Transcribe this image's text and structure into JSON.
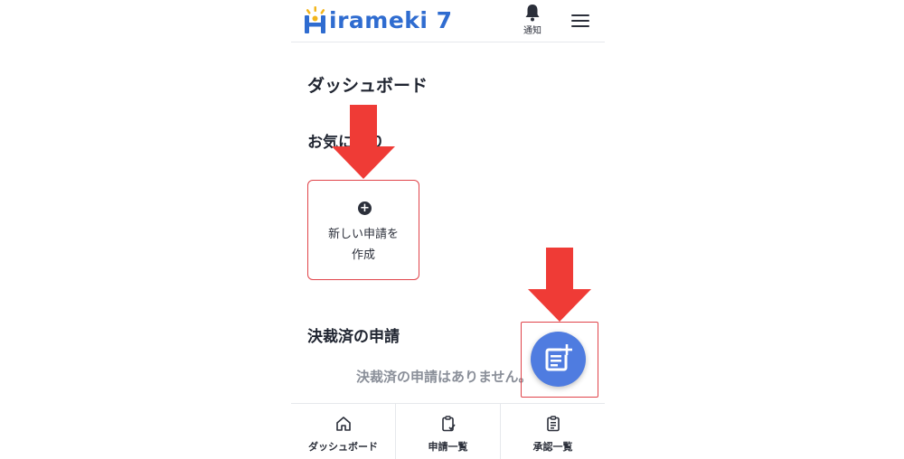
{
  "app": {
    "logo_text": "irameki 7",
    "brand_color": "#2f6cd0"
  },
  "header": {
    "notification_label": "通知",
    "notification_icon": "bell-icon",
    "menu_icon": "hamburger-menu-icon"
  },
  "page": {
    "title": "ダッシュボード"
  },
  "favorites": {
    "title": "お気に入り",
    "new_request_line1": "新しい申請を",
    "new_request_line2": "作成",
    "new_request_icon": "plus-circle-icon"
  },
  "approved": {
    "title": "決裁済の申請",
    "empty_message": "決裁済の申請はありません。"
  },
  "fab": {
    "icon": "document-add-icon",
    "color": "#4f7ce0"
  },
  "bottom_nav": {
    "items": [
      {
        "label": "ダッシュボード",
        "icon": "home-icon"
      },
      {
        "label": "申請一覧",
        "icon": "clipboard-check-icon"
      },
      {
        "label": "承認一覧",
        "icon": "clipboard-list-icon"
      }
    ]
  },
  "annotations": {
    "highlight_color": "#e0444a",
    "arrow_color": "#ef3b36"
  }
}
